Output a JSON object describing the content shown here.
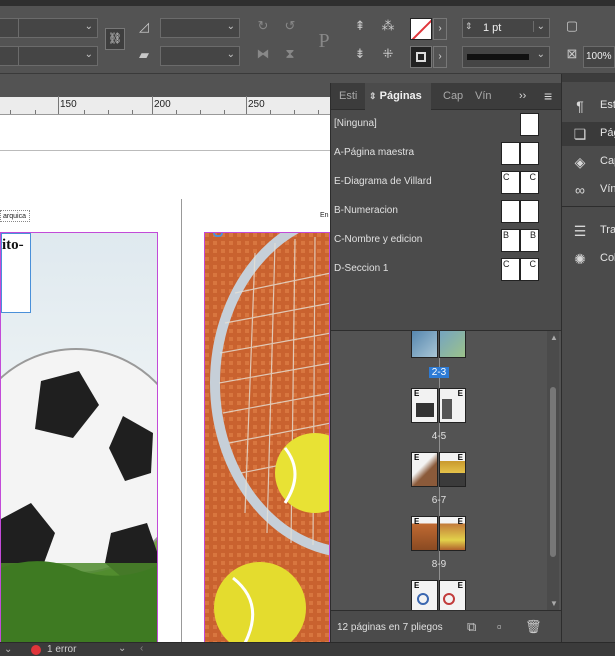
{
  "control_bar": {
    "stroke_weight": "1 pt",
    "zoom": "100%",
    "chain_icon": "chain-icon"
  },
  "ruler": {
    "labels": [
      "150",
      "200",
      "250"
    ]
  },
  "document": {
    "small_label_left": "arquica",
    "small_label_right": "En",
    "headline_fragment": "ito-"
  },
  "pages_panel": {
    "tabs": [
      "Esti",
      "Páginas",
      "Cap",
      "Vín"
    ],
    "menu_symbol": "≡",
    "expand_symbol": "››",
    "masters": [
      {
        "name": "[Ninguna]",
        "left": "",
        "right": "",
        "single": true
      },
      {
        "name": "A-Página maestra",
        "left": "",
        "right": "",
        "single": false
      },
      {
        "name": "E-Diagrama de Villard",
        "left": "C",
        "right": "C",
        "single": false
      },
      {
        "name": "B-Numeracion",
        "left": "",
        "right": "",
        "single": false
      },
      {
        "name": "C-Nombre y edicion",
        "left": "B",
        "right": "B",
        "single": false
      },
      {
        "name": "D-Seccion 1",
        "left": "C",
        "right": "C",
        "single": false
      }
    ],
    "spreads": [
      {
        "label": "2-3",
        "selected": true,
        "left_prefix": "",
        "right_prefix": ""
      },
      {
        "label": "4-5",
        "selected": false,
        "left_prefix": "E",
        "right_prefix": "E"
      },
      {
        "label": "6-7",
        "selected": false,
        "left_prefix": "E",
        "right_prefix": "E"
      },
      {
        "label": "8-9",
        "selected": false,
        "left_prefix": "E",
        "right_prefix": "E"
      },
      {
        "label": "",
        "selected": false,
        "left_prefix": "E",
        "right_prefix": "E"
      }
    ],
    "footer_text": "12 páginas en 7 pliegos"
  },
  "right_panel": {
    "items": [
      {
        "label": "Esti",
        "icon": "paragraph-styles-icon"
      },
      {
        "label": "Pág",
        "icon": "pages-icon",
        "active": true
      },
      {
        "label": "Cap",
        "icon": "layers-icon"
      },
      {
        "label": "Vín",
        "icon": "links-icon"
      },
      {
        "label": "Tra",
        "icon": "stroke-icon"
      },
      {
        "label": "Col",
        "icon": "color-icon"
      }
    ]
  },
  "status": {
    "error_text": "1 error"
  },
  "colors": {
    "accent": "#2d7bd5",
    "error": "#e0353a",
    "frame_magenta": "#c24ad8"
  }
}
